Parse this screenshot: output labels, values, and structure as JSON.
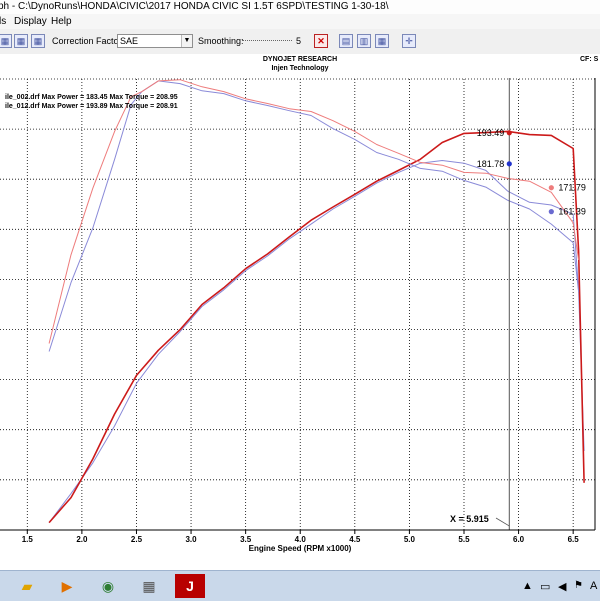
{
  "window": {
    "title": "ph - C:\\DynoRuns\\HONDA\\CIVIC\\2017 HONDA CIVIC SI 1.5T 6SPD\\TESTING 1-30-18\\"
  },
  "menu": {
    "items": [
      "ls",
      "Display",
      "Help"
    ]
  },
  "toolbar": {
    "correction_label": "Correction Factor:",
    "correction_value": "SAE",
    "smoothing_label": "Smoothing:",
    "smoothing_value": "5"
  },
  "chart_header": {
    "company": "DYNOJET RESEARCH",
    "subtitle": "Injen Technology",
    "cf_label": "CF: S"
  },
  "legend": [
    "ile_002.drf Max Power = 183.45 Max Torque = 208.95",
    "ile_012.drf Max Power = 193.89 Max Torque = 208.91"
  ],
  "cursor": {
    "label": "X = 5.915"
  },
  "chart_data": {
    "type": "line",
    "xlabel": "Engine Speed (RPM x1000)",
    "ylabel": "",
    "xlim": [
      1.25,
      6.7
    ],
    "ylim": [
      0,
      10
    ],
    "x_ticks": [
      "1.5",
      "2.0",
      "2.5",
      "3.0",
      "3.5",
      "4.0",
      "4.5",
      "5.0",
      "5.5",
      "6.0",
      "6.5"
    ],
    "grid": true,
    "series": [
      {
        "name": "ile_002.drf power",
        "color": "#8a8ad8",
        "x": [
          1.7,
          1.9,
          2.1,
          2.3,
          2.5,
          2.7,
          2.9,
          3.1,
          3.3,
          3.5,
          3.7,
          3.9,
          4.1,
          4.3,
          4.5,
          4.7,
          4.9,
          5.1,
          5.3,
          5.5,
          5.7,
          5.9,
          6.1,
          6.3,
          6.5,
          6.55,
          6.6
        ],
        "y": [
          0.2,
          0.9,
          1.7,
          2.6,
          3.7,
          4.4,
          5.0,
          5.6,
          6.05,
          6.5,
          6.9,
          7.3,
          7.7,
          8.05,
          8.4,
          8.7,
          9.0,
          9.2,
          9.3,
          9.2,
          9.05,
          8.5,
          8.25,
          8.15,
          7.95,
          6.0,
          2.0
        ]
      },
      {
        "name": "ile_012.drf power",
        "color": "#cc1a1a",
        "x": [
          1.7,
          1.9,
          2.1,
          2.3,
          2.5,
          2.7,
          2.9,
          3.1,
          3.3,
          3.5,
          3.7,
          3.9,
          4.1,
          4.3,
          4.5,
          4.7,
          4.9,
          5.1,
          5.3,
          5.5,
          5.7,
          5.9,
          6.1,
          6.3,
          6.5,
          6.55,
          6.6
        ],
        "y": [
          0.2,
          0.8,
          1.8,
          2.9,
          3.9,
          4.5,
          5.05,
          5.65,
          6.1,
          6.55,
          6.95,
          7.35,
          7.8,
          8.1,
          8.45,
          8.75,
          9.05,
          9.3,
          9.75,
          9.95,
          10.0,
          10.0,
          9.95,
          9.9,
          9.6,
          7.0,
          1.2
        ]
      },
      {
        "name": "ile_002.drf torque",
        "color": "#8a8ad8",
        "x": [
          1.7,
          1.9,
          2.1,
          2.3,
          2.45,
          2.55,
          2.7,
          2.9,
          3.1,
          3.3,
          3.5,
          3.7,
          3.9,
          4.1,
          4.3,
          4.5,
          4.7,
          4.9,
          5.1,
          5.3,
          5.5,
          5.7,
          5.9,
          6.1,
          6.3,
          6.5,
          6.55
        ],
        "y": [
          4.5,
          6.2,
          7.6,
          9.3,
          10.7,
          11.0,
          11.3,
          11.2,
          11.05,
          10.95,
          10.8,
          10.65,
          10.55,
          10.4,
          10.1,
          9.8,
          9.5,
          9.3,
          9.1,
          9.0,
          8.8,
          8.6,
          8.3,
          8.05,
          7.7,
          7.2,
          6.0
        ]
      },
      {
        "name": "ile_012.drf torque",
        "color": "#ee7c7c",
        "x": [
          1.7,
          1.9,
          2.1,
          2.3,
          2.45,
          2.55,
          2.7,
          2.9,
          3.1,
          3.3,
          3.5,
          3.7,
          3.9,
          4.1,
          4.3,
          4.5,
          4.7,
          4.9,
          5.1,
          5.3,
          5.5,
          5.7,
          5.9,
          6.1,
          6.3,
          6.5,
          6.55
        ],
        "y": [
          4.7,
          6.9,
          8.6,
          10.0,
          10.9,
          11.0,
          11.3,
          11.3,
          11.15,
          11.0,
          10.85,
          10.7,
          10.6,
          10.5,
          10.3,
          10.0,
          9.7,
          9.45,
          9.25,
          9.15,
          9.0,
          8.95,
          8.85,
          8.75,
          8.5,
          7.7,
          6.8
        ]
      }
    ],
    "annotations": [
      {
        "text": "193.49",
        "x": 5.915,
        "y": 9.98,
        "color": "#cc1a1a",
        "side": "left"
      },
      {
        "text": "181.78",
        "x": 5.915,
        "y": 9.2,
        "color": "#2233cc",
        "side": "left"
      },
      {
        "text": "171.79",
        "x": 6.3,
        "y": 8.6,
        "color": "#ee7c7c",
        "side": "right"
      },
      {
        "text": "161.39",
        "x": 6.3,
        "y": 8.0,
        "color": "#6a6ad0",
        "side": "right"
      }
    ],
    "cursor_x": 5.915
  },
  "taskbar": {
    "apps": [
      "file-explorer",
      "media-player",
      "chrome",
      "calculator",
      "dynojet-winpep"
    ],
    "tray_letter": "A"
  }
}
